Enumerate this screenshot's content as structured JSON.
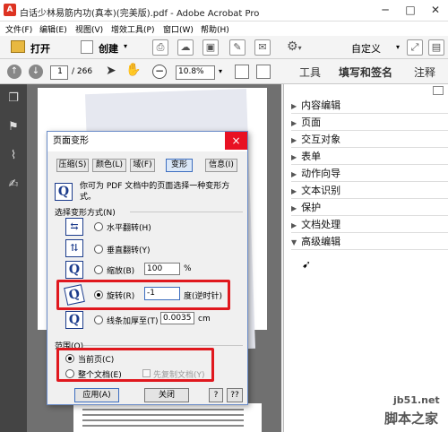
{
  "window": {
    "title": "白话少林易筋内功(真本)(完美版).pdf - Adobe Acrobat Pro",
    "app_icon": "pdf-icon"
  },
  "menubar": {
    "items": [
      "文件(F)",
      "编辑(E)",
      "视图(V)",
      "增效工具(P)",
      "窗口(W)",
      "帮助(H)"
    ]
  },
  "toolbar": {
    "open_label": "打开",
    "create_label": "创建",
    "customize_label": "自定义"
  },
  "nav": {
    "page_current": "1",
    "page_total": "/ 266",
    "zoom": "10.8%",
    "tab_tools": "工具",
    "tab_fill_sign": "填写和签名",
    "tab_comment": "注释"
  },
  "panel": {
    "items": [
      "内容编辑",
      "页面",
      "交互对象",
      "表单",
      "动作向导",
      "文本识别",
      "保护",
      "文档处理",
      "高级编辑"
    ],
    "expanded_index": 8
  },
  "dialog": {
    "title": "页面变形",
    "close_glyph": "×",
    "tabs": [
      "压缩(S)",
      "颜色(L)",
      "域(F)",
      "变形",
      "信息(I)"
    ],
    "selected_tab": 3,
    "description": "你可为 PDF 文档中的页面选择一种变形方式。",
    "group_label": "选择变形方式(N)",
    "options": {
      "flip_h": "水平翻转(H)",
      "flip_v": "垂直翻转(Y)",
      "scale": "缩放(B)",
      "scale_value": "100",
      "scale_unit": "%",
      "rotate": "旋转(R)",
      "rotate_value": "-1",
      "rotate_unit": "度(逆时针)",
      "thicken": "线条加厚至(T)",
      "thicken_value": "0.0035",
      "thicken_unit": "cm"
    },
    "range": {
      "label": "范围(O)",
      "current_page": "当前页(C)",
      "whole_doc": "整个文档(E)",
      "copy_doc": "先复制文档(Y)"
    },
    "buttons": {
      "apply": "应用(A)",
      "close": "关闭",
      "help1": "?",
      "help2": "??"
    }
  },
  "watermark": {
    "site": "jb51.net",
    "name": "脚本之家"
  }
}
